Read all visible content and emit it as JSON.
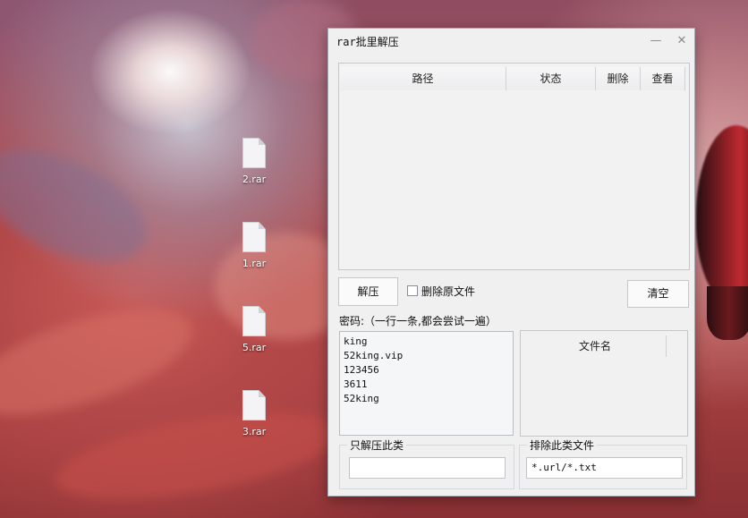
{
  "desktop": {
    "files": [
      {
        "name": "2.rar"
      },
      {
        "name": "1.rar"
      },
      {
        "name": "5.rar"
      },
      {
        "name": "3.rar"
      }
    ]
  },
  "window": {
    "title": "rar批里解压",
    "minimize_glyph": "—",
    "close_glyph": "✕",
    "list_columns": [
      "路径",
      "状态",
      "删除",
      "查看"
    ],
    "extract_label": "解压",
    "delete_original_label": "删除原文件",
    "delete_original_checked": false,
    "clear_label": "清空",
    "password_label": "密码:（一行一条,都会尝试一遍）",
    "passwords": [
      "king",
      "52king.vip",
      "123456",
      "3611",
      "52king"
    ],
    "filename_column": "文件名",
    "only_extract_title": "只解压此类",
    "only_extract_value": "",
    "exclude_title": "排除此类文件",
    "exclude_value": "*.url/*.txt"
  }
}
